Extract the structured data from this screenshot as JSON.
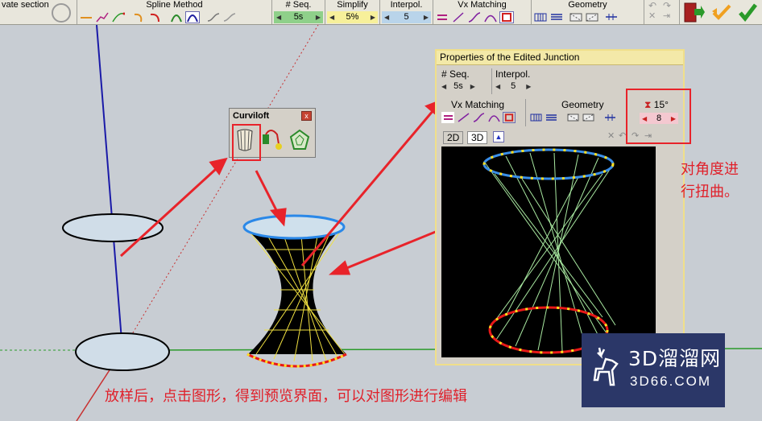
{
  "toolbar": {
    "section_label": "vate section",
    "spline_method_label": "Spline Method",
    "seq_label": "# Seq.",
    "seq_value": "5s",
    "simplify_label": "Simplify",
    "simplify_value": "5%",
    "interpol_label": "Interpol.",
    "interpol_value": "5",
    "vx_matching_label": "Vx Matching",
    "geometry_label": "Geometry"
  },
  "curviloft": {
    "title": "Curviloft",
    "close_glyph": "x"
  },
  "props": {
    "title": "Properties of the Edited Junction",
    "seq_label": "# Seq.",
    "seq_value": "5s",
    "interpol_label": "Interpol.",
    "interpol_value": "5",
    "vx_matching_label": "Vx Matching",
    "geometry_label": "Geometry",
    "twist_angle": "15°",
    "twist_value": "8",
    "tab_2d": "2D",
    "tab_3d": "3D"
  },
  "annotations": {
    "twist_note_line1": "对角度进",
    "twist_note_line2": "行扭曲。",
    "bottom_note": "放样后，点击图形，得到预览界面，可以对图形进行编辑"
  },
  "watermark": {
    "line1": "3D溜溜网",
    "line2": "3D66.COM"
  },
  "colors": {
    "accent_red": "#e8232a",
    "blue_ring": "#3a8ee8",
    "red_ring": "#e81818",
    "yellow_dots": "#ffe020",
    "loft_lines": "#a8e8a0"
  }
}
